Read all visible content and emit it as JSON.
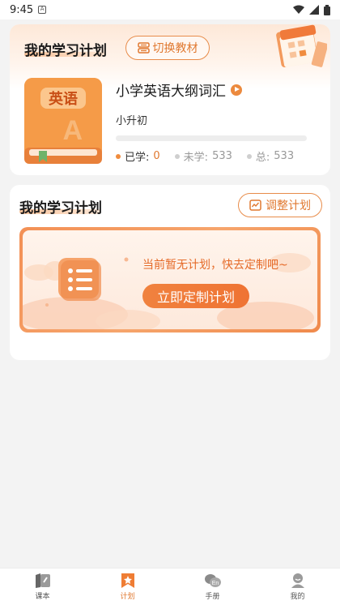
{
  "status_bar": {
    "time": "9:45"
  },
  "plan_card": {
    "title": "我的学习计划",
    "switch_button": "切换教材",
    "book": {
      "cover_text": "英语",
      "cover_letter": "A",
      "name": "小学英语大纲词汇",
      "level": "小升初",
      "progress_fraction": 0
    },
    "stats": {
      "learned_label": "已学:",
      "learned_value": "0",
      "unlearned_label": "未学:",
      "unlearned_value": "533",
      "total_label": "总:",
      "total_value": "533"
    }
  },
  "schedule_card": {
    "title": "我的学习计划",
    "adjust_button": "调整计划",
    "empty_text": "当前暂无计划，快去定制吧~",
    "create_button": "立即定制计划"
  },
  "bottom_nav": {
    "items": [
      {
        "label": "课本",
        "icon": "textbook-icon",
        "active": false
      },
      {
        "label": "计划",
        "icon": "plan-star-icon",
        "active": true
      },
      {
        "label": "手册",
        "icon": "handbook-icon",
        "active": false
      },
      {
        "label": "我的",
        "icon": "profile-icon",
        "active": false
      }
    ]
  },
  "colors": {
    "accent": "#f08c3e",
    "background": "#f3f3f3"
  }
}
